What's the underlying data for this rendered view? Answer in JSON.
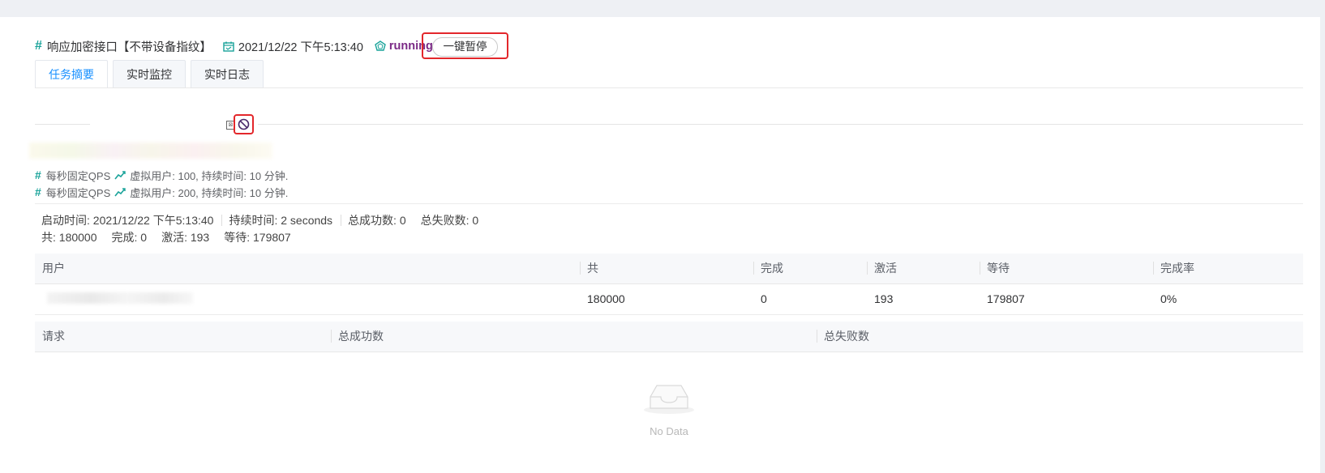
{
  "header": {
    "title": "响应加密接口【不带设备指纹】",
    "datetime": "2021/12/22 下午5:13:40",
    "status": "running",
    "pause_button": "一键暂停"
  },
  "tabs": [
    {
      "label": "任务摘要",
      "active": true
    },
    {
      "label": "实时监控",
      "active": false
    },
    {
      "label": "实时日志",
      "active": false
    }
  ],
  "load_profiles": [
    {
      "type": "每秒固定QPS",
      "detail": "虚拟用户: 100, 持续时间: 10 分钟."
    },
    {
      "type": "每秒固定QPS",
      "detail": "虚拟用户: 200, 持续时间: 10 分钟."
    }
  ],
  "summary": {
    "start_time": "启动时间: 2021/12/22 下午5:13:40",
    "duration": "持续时间: 2 seconds",
    "total_success": "总成功数: 0",
    "total_fail": "总失败数: 0",
    "total": "共: 180000",
    "done": "完成: 0",
    "active": "激活: 193",
    "waiting": "等待: 179807"
  },
  "users_table": {
    "headers": [
      "用户",
      "共",
      "完成",
      "激活",
      "等待",
      "完成率"
    ],
    "row": {
      "total": "180000",
      "done": "0",
      "active": "193",
      "waiting": "179807",
      "rate": "0%"
    }
  },
  "requests_table": {
    "headers": [
      "请求",
      "总成功数",
      "总失败数"
    ],
    "empty_text": "No Data"
  },
  "colors": {
    "accent": "#1890ff",
    "hash": "#1aa39a",
    "status": "#7b2a86",
    "highlight": "#e3272b"
  },
  "icons": [
    "hash-icon",
    "calendar-icon",
    "status-icon",
    "broken-image-icon",
    "block-icon",
    "trend-icon",
    "inbox-icon"
  ]
}
